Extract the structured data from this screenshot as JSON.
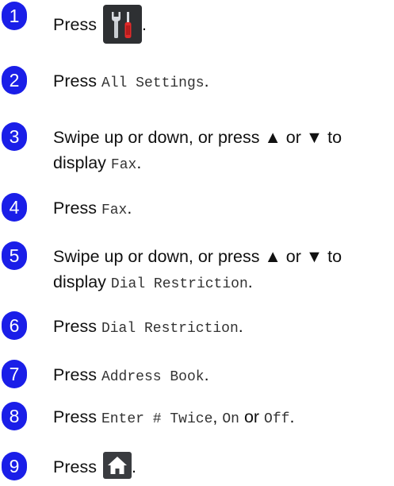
{
  "steps": [
    {
      "number": "1",
      "press": "Press",
      "icon": "settings-tools-icon",
      "end": "."
    },
    {
      "number": "2",
      "press": "Press",
      "item": "All Settings",
      "end": "."
    },
    {
      "number": "3",
      "line1": "Swipe up or down, or press ▲ or ▼ to",
      "line2": "display",
      "item": "Fax",
      "end": "."
    },
    {
      "number": "4",
      "press": "Press",
      "item": "Fax",
      "end": "."
    },
    {
      "number": "5",
      "line1": "Swipe up or down, or press ▲ or ▼ to",
      "line2": "display",
      "item": "Dial Restriction",
      "end": "."
    },
    {
      "number": "6",
      "press": "Press",
      "item": "Dial Restriction",
      "end": "."
    },
    {
      "number": "7",
      "press": "Press",
      "item": "Address Book",
      "end": "."
    },
    {
      "number": "8",
      "press": "Press",
      "item": "Enter # Twice",
      "sep1": ", ",
      "item2": "On",
      "sep2": "or",
      "item3": "Off",
      "end": "."
    },
    {
      "number": "9",
      "press": "Press",
      "icon": "home-icon",
      "end": "."
    }
  ],
  "colors": {
    "badge": "#1a1ee8",
    "icon_bg": "#2e3033"
  }
}
